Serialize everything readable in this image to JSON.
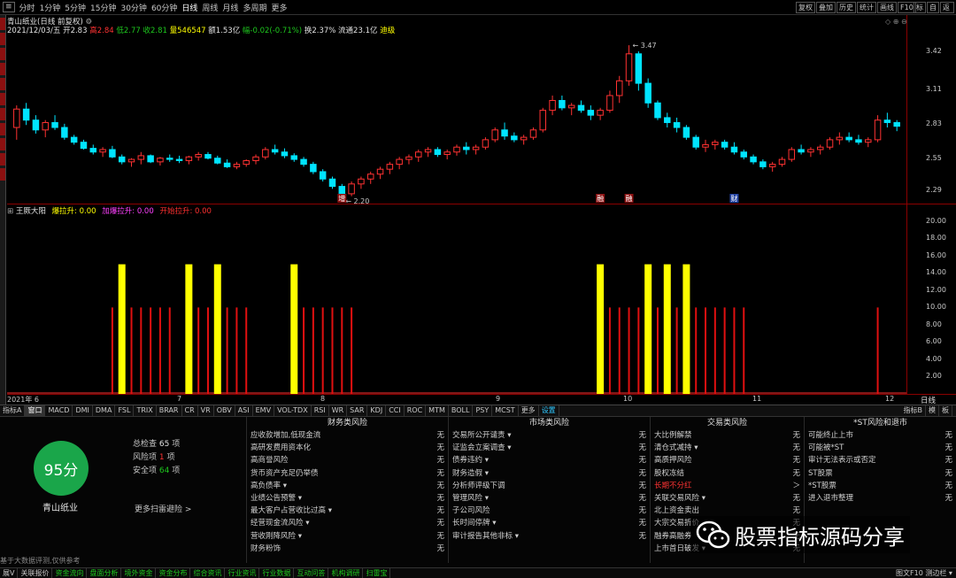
{
  "toolbar": {
    "periods": [
      "分时",
      "1分钟",
      "5分钟",
      "15分钟",
      "30分钟",
      "60分钟",
      "日线",
      "周线",
      "月线",
      "多周期",
      "更多"
    ],
    "active_period": "日线",
    "right_buttons": [
      "复权",
      "叠加",
      "历史",
      "统计",
      "画线",
      "F10",
      "标记",
      "自选",
      "返回"
    ]
  },
  "quote": {
    "title": "青山纸业(日线 前复权)",
    "date": "2021/12/03/五",
    "open": "开2.83",
    "high": "高2.84",
    "low": "低2.77",
    "close": "收2.81",
    "volume": "量546547",
    "amount": "额1.53亿",
    "change": "幅-0.02(-0.71%)",
    "turnover": "换2.37%",
    "float_cap": "流通23.1亿",
    "extra": "迪级"
  },
  "main_axis_ticks": [
    "3.42",
    "3.11",
    "2.83",
    "2.55",
    "2.29"
  ],
  "price_annotations": {
    "high": "3.47",
    "low": "2.20"
  },
  "event_markers": [
    "增",
    "融",
    "融",
    "财"
  ],
  "indicator": {
    "name": "王厥大阳",
    "lines": [
      {
        "label": "爆拉升: 0.00",
        "color": "#ffff00"
      },
      {
        "label": "加爆拉升: 0.00",
        "color": "#ff40ff"
      },
      {
        "label": "开始拉升: 0.00",
        "color": "#ff3030"
      }
    ],
    "axis_ticks": [
      "20.00",
      "18.00",
      "16.00",
      "14.00",
      "12.00",
      "10.00",
      "8.00",
      "6.00",
      "4.00",
      "2.00"
    ]
  },
  "time_axis": [
    "2021年 6",
    "7",
    "8",
    "9",
    "10",
    "11",
    "12"
  ],
  "axis_right_label": "日线",
  "indicator_tabs": [
    "指标A",
    "窗口",
    "MACD",
    "DMI",
    "DMA",
    "FSL",
    "TRIX",
    "BRAR",
    "CR",
    "VR",
    "OBV",
    "ASI",
    "EMV",
    "VOL-TDX",
    "RSI",
    "WR",
    "SAR",
    "KDJ",
    "CCI",
    "ROC",
    "MTM",
    "BOLL",
    "PSY",
    "MCST",
    "更多",
    "设置"
  ],
  "indicator_tabs_right": [
    "指标B",
    "模",
    "板"
  ],
  "risk": {
    "score": "95分",
    "stock_name": "青山纸业",
    "total_label": "总检查",
    "total_value": "65",
    "total_unit": "项",
    "risk_label": "风险项",
    "risk_value": "1",
    "risk_unit": "项",
    "safe_label": "安全项",
    "safe_value": "64",
    "safe_unit": "项",
    "more_link": "更多扫雷避险 >",
    "footnote": "基于大数据评测,仅供参考",
    "columns": [
      {
        "title": "财务类风险",
        "rows": [
          [
            "应收款增加,低现金流",
            "无"
          ],
          [
            "高研发费用资本化",
            "无"
          ],
          [
            "高商誉风险",
            "无"
          ],
          [
            "货币资产充足仍举债",
            "无"
          ],
          [
            "高负债率 ▾",
            "无"
          ],
          [
            "业绩公告预警 ▾",
            "无"
          ],
          [
            "最大客户占营收比过高 ▾",
            "无"
          ],
          [
            "经营现金流风险 ▾",
            "无"
          ],
          [
            "营收刚降风险 ▾",
            "无"
          ],
          [
            "财务粉饰",
            "无"
          ]
        ]
      },
      {
        "title": "市场类风险",
        "rows": [
          [
            "交易所公开谴责 ▾",
            "无"
          ],
          [
            "证监会立案调查 ▾",
            "无"
          ],
          [
            "债券违约 ▾",
            "无"
          ],
          [
            "财务造假 ▾",
            "无"
          ],
          [
            "分析师评级下调",
            "无"
          ],
          [
            "管理风险 ▾",
            "无"
          ],
          [
            "子公司风险",
            "无"
          ],
          [
            "长时间停牌 ▾",
            "无"
          ],
          [
            "审计报告其他非标 ▾",
            "无"
          ]
        ]
      },
      {
        "title": "交易类风险",
        "rows": [
          [
            "大比例解禁",
            "无"
          ],
          [
            "清仓式减持 ▾",
            "无"
          ],
          [
            "高质押风险",
            "无"
          ],
          [
            "股权冻结",
            "无"
          ],
          [
            "长期不分红",
            "＞"
          ],
          [
            "关联交易风险 ▾",
            "无"
          ],
          [
            "北上资金卖出",
            "无"
          ],
          [
            "大宗交易折价",
            "无"
          ],
          [
            "融券高融券",
            "无"
          ],
          [
            "上市首日破发 ▾",
            "无"
          ]
        ]
      },
      {
        "title": "*ST风险和退市",
        "rows": [
          [
            "可能终止上市",
            "无"
          ],
          [
            "可能被*ST",
            "无"
          ],
          [
            "审计无法表示或否定",
            "无"
          ],
          [
            "ST股票",
            "无"
          ],
          [
            "*ST股票",
            "无"
          ],
          [
            "进入退市整理",
            "无"
          ]
        ]
      }
    ],
    "highlight_row": "长期不分红"
  },
  "watermark": "股票指标源码分享",
  "bottom_tabs": [
    "展V",
    "关联报价",
    "资金流向",
    "盘面分析",
    "境外资金",
    "资金分布",
    "综合资讯",
    "行业资讯",
    "行业数据",
    "互动问答",
    "机构调研",
    "扫雷宝"
  ],
  "bottom_right": "图文F10 测边栏 ▾",
  "colors": {
    "up": "#ff3232",
    "down": "#00e4ff",
    "axis": "#8b0000",
    "yellow": "#ffff00",
    "red_bar": "#e01010",
    "score": "#1aa64a"
  },
  "chart_data": [
    {
      "type": "candlestick",
      "title": "青山纸业(日线 前复权)",
      "ylim": [
        2.18,
        3.55
      ],
      "y_ticks": [
        3.42,
        3.11,
        2.83,
        2.55,
        2.29
      ],
      "x_month_labels": [
        "6",
        "7",
        "8",
        "9",
        "10",
        "11",
        "12"
      ],
      "ohlc": [
        [
          2.8,
          2.98,
          2.7,
          2.95
        ],
        [
          2.95,
          3.0,
          2.82,
          2.86
        ],
        [
          2.86,
          2.9,
          2.75,
          2.78
        ],
        [
          2.78,
          2.86,
          2.72,
          2.84
        ],
        [
          2.84,
          2.9,
          2.78,
          2.8
        ],
        [
          2.8,
          2.83,
          2.7,
          2.72
        ],
        [
          2.72,
          2.74,
          2.66,
          2.68
        ],
        [
          2.68,
          2.7,
          2.62,
          2.63
        ],
        [
          2.63,
          2.66,
          2.58,
          2.6
        ],
        [
          2.6,
          2.64,
          2.56,
          2.62
        ],
        [
          2.62,
          2.65,
          2.55,
          2.56
        ],
        [
          2.56,
          2.58,
          2.5,
          2.52
        ],
        [
          2.52,
          2.55,
          2.48,
          2.54
        ],
        [
          2.54,
          2.6,
          2.5,
          2.57
        ],
        [
          2.57,
          2.58,
          2.51,
          2.52
        ],
        [
          2.52,
          2.56,
          2.49,
          2.55
        ],
        [
          2.55,
          2.58,
          2.52,
          2.54
        ],
        [
          2.54,
          2.57,
          2.51,
          2.53
        ],
        [
          2.53,
          2.57,
          2.5,
          2.56
        ],
        [
          2.56,
          2.6,
          2.53,
          2.58
        ],
        [
          2.58,
          2.6,
          2.54,
          2.55
        ],
        [
          2.55,
          2.57,
          2.5,
          2.51
        ],
        [
          2.51,
          2.54,
          2.47,
          2.48
        ],
        [
          2.48,
          2.52,
          2.46,
          2.5
        ],
        [
          2.5,
          2.54,
          2.48,
          2.53
        ],
        [
          2.53,
          2.58,
          2.5,
          2.56
        ],
        [
          2.56,
          2.64,
          2.54,
          2.62
        ],
        [
          2.62,
          2.66,
          2.58,
          2.6
        ],
        [
          2.6,
          2.63,
          2.55,
          2.57
        ],
        [
          2.57,
          2.59,
          2.52,
          2.54
        ],
        [
          2.54,
          2.56,
          2.48,
          2.5
        ],
        [
          2.5,
          2.52,
          2.42,
          2.44
        ],
        [
          2.44,
          2.46,
          2.36,
          2.38
        ],
        [
          2.38,
          2.4,
          2.3,
          2.32
        ],
        [
          2.32,
          2.34,
          2.2,
          2.26
        ],
        [
          2.26,
          2.36,
          2.24,
          2.34
        ],
        [
          2.34,
          2.4,
          2.3,
          2.38
        ],
        [
          2.38,
          2.44,
          2.34,
          2.42
        ],
        [
          2.42,
          2.48,
          2.38,
          2.46
        ],
        [
          2.46,
          2.52,
          2.42,
          2.5
        ],
        [
          2.5,
          2.56,
          2.46,
          2.54
        ],
        [
          2.54,
          2.58,
          2.5,
          2.56
        ],
        [
          2.56,
          2.62,
          2.52,
          2.6
        ],
        [
          2.6,
          2.64,
          2.56,
          2.62
        ],
        [
          2.62,
          2.64,
          2.56,
          2.58
        ],
        [
          2.58,
          2.62,
          2.54,
          2.6
        ],
        [
          2.6,
          2.66,
          2.57,
          2.64
        ],
        [
          2.64,
          2.68,
          2.58,
          2.62
        ],
        [
          2.62,
          2.66,
          2.58,
          2.64
        ],
        [
          2.64,
          2.72,
          2.62,
          2.7
        ],
        [
          2.7,
          2.8,
          2.68,
          2.78
        ],
        [
          2.78,
          2.84,
          2.7,
          2.73
        ],
        [
          2.73,
          2.76,
          2.68,
          2.7
        ],
        [
          2.7,
          2.74,
          2.66,
          2.72
        ],
        [
          2.72,
          2.8,
          2.7,
          2.78
        ],
        [
          2.78,
          2.96,
          2.76,
          2.94
        ],
        [
          2.94,
          3.06,
          2.9,
          3.02
        ],
        [
          3.02,
          3.06,
          2.94,
          2.96
        ],
        [
          2.96,
          3.0,
          2.9,
          2.98
        ],
        [
          2.98,
          3.02,
          2.92,
          2.94
        ],
        [
          2.94,
          2.98,
          2.86,
          2.9
        ],
        [
          2.9,
          2.96,
          2.86,
          2.94
        ],
        [
          2.94,
          3.1,
          2.92,
          3.06
        ],
        [
          3.06,
          3.22,
          3.0,
          3.18
        ],
        [
          3.18,
          3.47,
          3.14,
          3.4
        ],
        [
          3.4,
          3.42,
          3.1,
          3.16
        ],
        [
          3.16,
          3.2,
          2.96,
          3.0
        ],
        [
          3.0,
          3.02,
          2.86,
          2.88
        ],
        [
          2.88,
          2.92,
          2.8,
          2.84
        ],
        [
          2.84,
          2.88,
          2.76,
          2.8
        ],
        [
          2.8,
          2.82,
          2.7,
          2.72
        ],
        [
          2.72,
          2.74,
          2.62,
          2.64
        ],
        [
          2.64,
          2.7,
          2.6,
          2.66
        ],
        [
          2.66,
          2.7,
          2.62,
          2.68
        ],
        [
          2.68,
          2.7,
          2.62,
          2.64
        ],
        [
          2.64,
          2.68,
          2.58,
          2.6
        ],
        [
          2.6,
          2.62,
          2.54,
          2.56
        ],
        [
          2.56,
          2.58,
          2.5,
          2.52
        ],
        [
          2.52,
          2.54,
          2.46,
          2.48
        ],
        [
          2.48,
          2.52,
          2.44,
          2.5
        ],
        [
          2.5,
          2.56,
          2.48,
          2.54
        ],
        [
          2.54,
          2.64,
          2.52,
          2.62
        ],
        [
          2.62,
          2.66,
          2.58,
          2.6
        ],
        [
          2.6,
          2.64,
          2.56,
          2.62
        ],
        [
          2.62,
          2.66,
          2.58,
          2.64
        ],
        [
          2.64,
          2.72,
          2.62,
          2.7
        ],
        [
          2.7,
          2.76,
          2.66,
          2.72
        ],
        [
          2.72,
          2.76,
          2.68,
          2.7
        ],
        [
          2.7,
          2.74,
          2.66,
          2.68
        ],
        [
          2.68,
          2.72,
          2.64,
          2.7
        ],
        [
          2.7,
          2.9,
          2.68,
          2.86
        ],
        [
          2.86,
          2.92,
          2.8,
          2.84
        ],
        [
          2.84,
          2.86,
          2.77,
          2.81
        ]
      ]
    },
    {
      "type": "bar",
      "title": "王厥大阳",
      "ylim": [
        0,
        21
      ],
      "series": [
        {
          "name": "爆拉升",
          "value": 15,
          "bar_indices": [
            11,
            18,
            21,
            29,
            61,
            66,
            68,
            70
          ]
        },
        {
          "name": "开始拉升",
          "value": 10,
          "bar_indices": [
            10,
            12,
            13,
            14,
            15,
            16,
            19,
            20,
            22,
            23,
            24,
            30,
            31,
            32,
            33,
            34,
            35,
            62,
            63,
            64,
            65,
            67,
            69,
            71,
            72,
            73,
            74,
            75,
            76,
            90
          ]
        }
      ]
    }
  ]
}
